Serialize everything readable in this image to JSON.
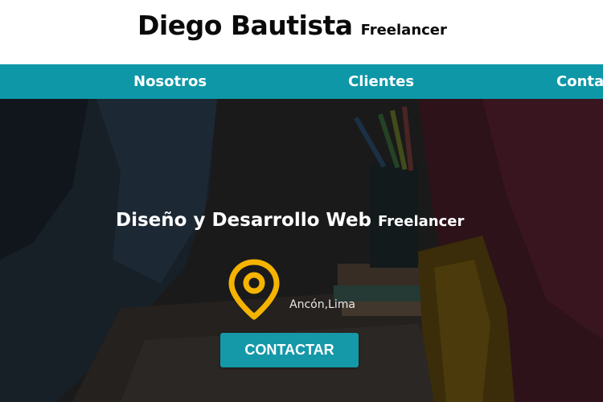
{
  "header": {
    "name": "Diego Bautista",
    "tagline": "Freelancer"
  },
  "nav": {
    "items": [
      "Nosotros",
      "Clientes",
      "Contacto"
    ]
  },
  "hero": {
    "title": "Diseño y Desarrollo Web",
    "title_tag": "Freelancer",
    "location": "Ancón,Lima",
    "cta_label": "CONTACTAR"
  },
  "colors": {
    "accent": "#0d97a7",
    "pin": "#f5b400",
    "text_dark": "#0a0a0a"
  },
  "icons": {
    "location": "map-pin-icon"
  }
}
